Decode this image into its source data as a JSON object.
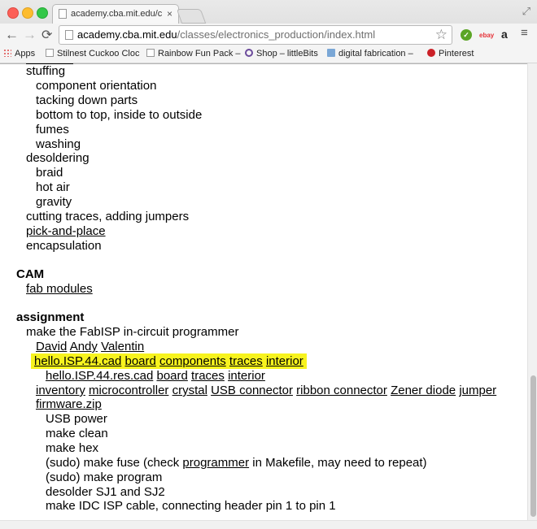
{
  "browser": {
    "tab_title": "academy.cba.mit.edu/class",
    "tab_close": "×",
    "url_host": "academy.cba.mit.edu",
    "url_path": "/classes/electronics_production/index.html",
    "icons": {
      "back": "←",
      "forward": "→",
      "reload": "⟳",
      "star": "☆",
      "fullscreen": "⤢",
      "menu": "≡"
    },
    "extensions": {
      "evernote": "✓",
      "ebay": "ebay",
      "amazon": "a"
    }
  },
  "bookmarks": [
    {
      "label": "Apps"
    },
    {
      "label": "Stilnest Cuckoo Cloc"
    },
    {
      "label": "Rainbow Fun Pack –"
    },
    {
      "label": "Shop – littleBits"
    },
    {
      "label": "digital fabrication –"
    },
    {
      "label": "Pinterest"
    }
  ],
  "content": {
    "stuffing": {
      "title": "stuffing",
      "items": [
        "component orientation",
        "tacking down parts",
        "bottom to top, inside to outside",
        "fumes",
        "washing"
      ]
    },
    "desoldering": {
      "title": "desoldering",
      "items": [
        "braid",
        "hot air",
        "gravity"
      ]
    },
    "cutting_traces": "cutting traces, adding jumpers",
    "pick_and_place": "pick-and-place",
    "encapsulation": "encapsulation",
    "cam": {
      "heading": "CAM",
      "fab_modules": "fab modules"
    },
    "assignment": {
      "heading": "assignment",
      "intro": "make the FabISP in-circuit programmer",
      "people": [
        "David",
        "Andy",
        "Valentin"
      ],
      "cad_links": [
        "hello.ISP.44.cad",
        "board",
        "components",
        "traces",
        "interior"
      ],
      "res_links": [
        "hello.ISP.44.res.cad",
        "board",
        "traces",
        "interior"
      ],
      "parts_links": [
        "inventory",
        "microcontroller",
        "crystal",
        "USB connector",
        "ribbon connector",
        "Zener diode",
        "jumper"
      ],
      "firmware": "firmware.zip",
      "steps": {
        "usb_power": "USB power",
        "make_clean": "make clean",
        "make_hex": "make hex",
        "fuse_pre": "(sudo) make fuse (check ",
        "fuse_link": "programmer",
        "fuse_post": " in Makefile, may need to repeat)",
        "make_program": "(sudo) make program",
        "desolder": "desolder SJ1 and SJ2",
        "idc": "make IDC ISP cable, connecting header pin 1 to pin 1"
      }
    }
  },
  "colors": {
    "highlight": "#f7f31e",
    "chrome": "#e9e9e9"
  }
}
